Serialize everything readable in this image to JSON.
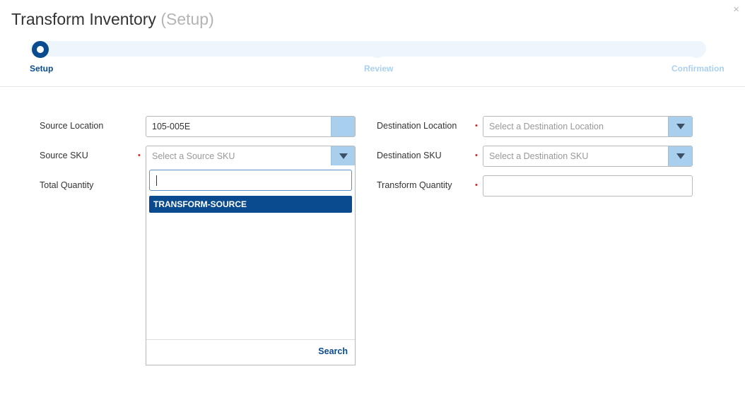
{
  "dialog": {
    "title": "Transform Inventory",
    "subtitle": "(Setup)",
    "close_glyph": "×"
  },
  "steps": [
    {
      "label": "Setup",
      "state": "active"
    },
    {
      "label": "Review",
      "state": "inactive"
    },
    {
      "label": "Confirmation",
      "state": "inactive"
    }
  ],
  "form": {
    "source_location": {
      "label": "Source Location",
      "value": "105-005E"
    },
    "source_sku": {
      "label": "Source SKU",
      "required_mark": "•",
      "placeholder": "Select a Source SKU"
    },
    "total_quantity": {
      "label": "Total Quantity"
    },
    "destination_location": {
      "label": "Destination Location",
      "required_mark": "•",
      "placeholder": "Select a Destination Location"
    },
    "destination_sku": {
      "label": "Destination SKU",
      "required_mark": "•",
      "placeholder": "Select a Destination SKU"
    },
    "transform_quantity": {
      "label": "Transform Quantity",
      "required_mark": "•",
      "value": ""
    }
  },
  "source_sku_dropdown": {
    "search_value": "",
    "options": [
      "TRANSFORM-SOURCE"
    ],
    "search_button_label": "Search"
  },
  "colors": {
    "accent": "#0a4a8f",
    "step_inactive": "#aad0ee",
    "dropdown_button": "#a8cfee",
    "required": "#e01d1d"
  },
  "icons": {
    "close": "close-icon",
    "dropdown": "chevron-down-icon"
  }
}
